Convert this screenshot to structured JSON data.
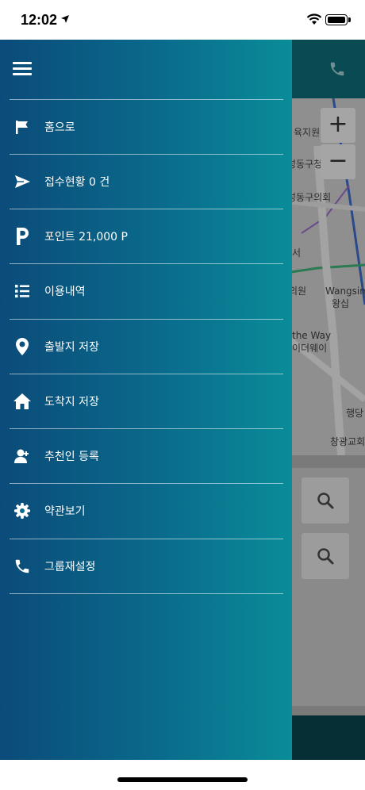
{
  "status_bar": {
    "time": "12:02"
  },
  "background_map": {
    "labels": {
      "l1": "육지원",
      "l2": "성동구청",
      "l3": "성동구의회",
      "l4": "서",
      "l5": "의원",
      "l6": "Wangsim",
      "l7": "왕십",
      "l8": "the Way",
      "l9": "이더웨이",
      "l10": "행당",
      "l11": "창광교회"
    },
    "zoom_in": "+",
    "zoom_out": "−"
  },
  "menu": {
    "items": [
      {
        "label": "홈으로",
        "icon": "flag-icon"
      },
      {
        "label": "접수현황 0 건",
        "icon": "send-icon"
      },
      {
        "label": "포인트 21,000 P",
        "icon": "parking-p-icon"
      },
      {
        "label": "이용내역",
        "icon": "list-icon"
      },
      {
        "label": "출발지 저장",
        "icon": "location-pin-icon"
      },
      {
        "label": "도착지 저장",
        "icon": "home-icon"
      },
      {
        "label": "추천인 등록",
        "icon": "user-add-icon"
      },
      {
        "label": "약관보기",
        "icon": "gear-icon"
      },
      {
        "label": "그룹재설정",
        "icon": "phone-icon"
      }
    ]
  },
  "colors": {
    "drawer_gradient_start": "#0b4b79",
    "drawer_gradient_end": "#0a8c99",
    "menu_text": "#ffffff"
  }
}
